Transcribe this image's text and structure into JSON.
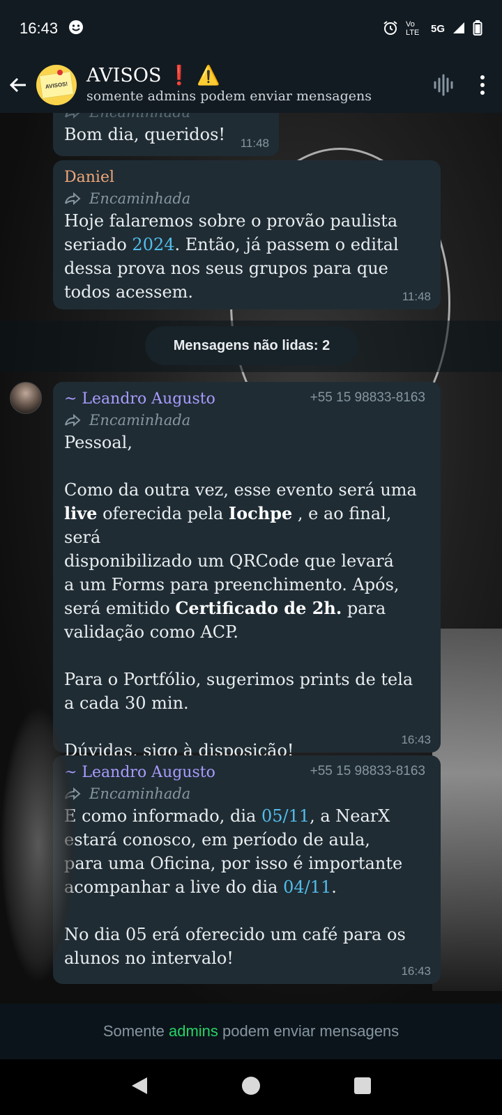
{
  "status_bar": {
    "time": "16:43",
    "network": "5G",
    "volte": "Vo LTE"
  },
  "header": {
    "title": "AVISOS",
    "title_emoji_exclamation": "❗",
    "title_emoji_warning": "⚠️",
    "subtitle": "somente admins podem enviar mensagens",
    "avatar_text": "AVISOS!"
  },
  "messages": [
    {
      "forwarded_label": "Encaminhada",
      "text": "Bom dia, queridos!",
      "time": "11:48"
    },
    {
      "sender": "Daniel",
      "forwarded_label": "Encaminhada",
      "text_before_link": "Hoje falaremos sobre o provão paulista\nseriado ",
      "link": "2024",
      "text_after_link": ". Então, já passem o edital\ndessa prova nos seus grupos para que\ntodos acessem.",
      "time": "11:48"
    },
    {
      "sender": "~ Leandro Augusto",
      "phone": "+55 15 98833-8163",
      "forwarded_label": "Encaminhada",
      "p1": "Pessoal,",
      "p2_a": "Como da outra vez, esse evento será uma\n",
      "p2_b1": "live",
      "p2_c": " oferecida pela ",
      "p2_b2": "Iochpe",
      "p2_d": " , e ao final, será\ndisponibilizado um QRCode que levará\na um Forms para preenchimento. Após,\nserá emitido ",
      "p2_b3": "Certificado de 2h.",
      "p2_e": " para\nvalidação como ACP.",
      "p3": "Para o Portfólio, sugerimos prints de tela\na cada 30 min.",
      "p4": "Dúvidas, sigo à disposição!",
      "time": "16:43"
    },
    {
      "sender": "~ Leandro Augusto",
      "phone": "+55 15 98833-8163",
      "forwarded_label": "Encaminhada",
      "t1": "E como informado, dia ",
      "link1": "05/11",
      "t2": ", a NearX\nestará conosco, em período de aula,\npara uma Oficina, por isso é importante\nacompanhar a live do dia ",
      "link2": "04/11",
      "t3": ".",
      "t4": "No dia 05 erá oferecido um café para os\nalunos no intervalo!",
      "time": "16:43"
    }
  ],
  "unread_label": "Mensagens não lidas: 2",
  "footer": {
    "prefix": "Somente ",
    "admins": "admins",
    "suffix": " podem enviar mensagens"
  },
  "colors": {
    "daniel": "#f0a87a",
    "leandro": "#a99cff",
    "link": "#53bdeb",
    "admins": "#25d366"
  }
}
